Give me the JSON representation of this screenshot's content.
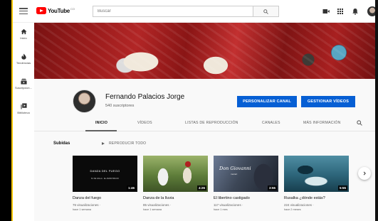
{
  "topbar": {
    "logo_text": "YouTube",
    "logo_country": "CO",
    "search_placeholder": "Buscar"
  },
  "sidebar": {
    "items": [
      {
        "label": "Inicio",
        "icon": "home-icon"
      },
      {
        "label": "Tendencias",
        "icon": "fire-icon"
      },
      {
        "label": "Suscripcion...",
        "icon": "subscriptions-icon"
      },
      {
        "label": "Biblioteca",
        "icon": "library-icon"
      }
    ]
  },
  "channel": {
    "name": "Fernando Palacios Jorge",
    "subscribers": "540 suscriptores",
    "customize_label": "PERSONALIZAR CANAL",
    "manage_label": "GESTIONAR VÍDEOS"
  },
  "tabs": [
    {
      "label": "INICIO",
      "active": true
    },
    {
      "label": "VÍDEOS"
    },
    {
      "label": "LISTAS DE REPRODUCCIÓN"
    },
    {
      "label": "CANALES"
    },
    {
      "label": "MÁS INFORMACIÓN"
    }
  ],
  "section": {
    "title": "Subidas",
    "play_all": "REPRODUCIR TODO"
  },
  "videos": [
    {
      "title": "Danza del fuego",
      "duration": "1:46",
      "views": "76 visualizaciones ·",
      "age": "hace 1 semana",
      "thumb_text": "DANZA DEL FUEGO",
      "thumb_sub": "M. DE FALLA · EL AMOR BRUJO"
    },
    {
      "title": "Danza de la lluvia",
      "duration": "4:26",
      "views": "85 visualizaciones ·",
      "age": "hace 1 semana"
    },
    {
      "title": "El libertino castigado",
      "duration": "3:55",
      "views": "117 visualizaciones ·",
      "age": "hace 1 mes",
      "thumb_text": "Don Giovanni",
      "thumb_sub": "mozart"
    },
    {
      "title": "Rusalka ¿dónde estás?",
      "duration": "5:55",
      "views": "224 visualizaciones ·",
      "age": "hace 2 meses"
    }
  ],
  "colors": {
    "accent": "#065fd4",
    "youtube_red": "#ff0000",
    "frame_yellow": "#f5c400"
  }
}
